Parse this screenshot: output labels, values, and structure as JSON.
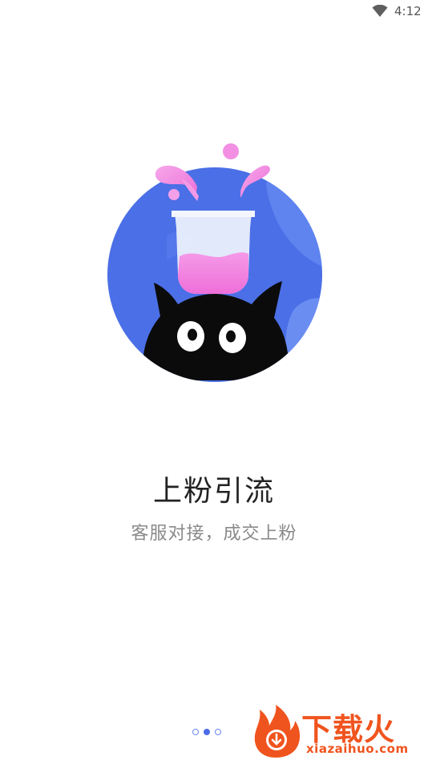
{
  "status_bar": {
    "time": "4:12",
    "wifi_icon": "wifi-icon"
  },
  "slide": {
    "title": "上粉引流",
    "subtitle": "客服对接，成交上粉",
    "illustration": "cat-with-beaker-illustration"
  },
  "pager": {
    "count": 3,
    "active_index": 1
  },
  "watermark": {
    "cn": "下载火",
    "en": "xiazaihuo.com",
    "logo": "flame-download-logo"
  },
  "colors": {
    "accent": "#4a6ae6",
    "circle": "#4b6fe6",
    "pink": "#f07ee0",
    "watermark": "#f0541e"
  }
}
